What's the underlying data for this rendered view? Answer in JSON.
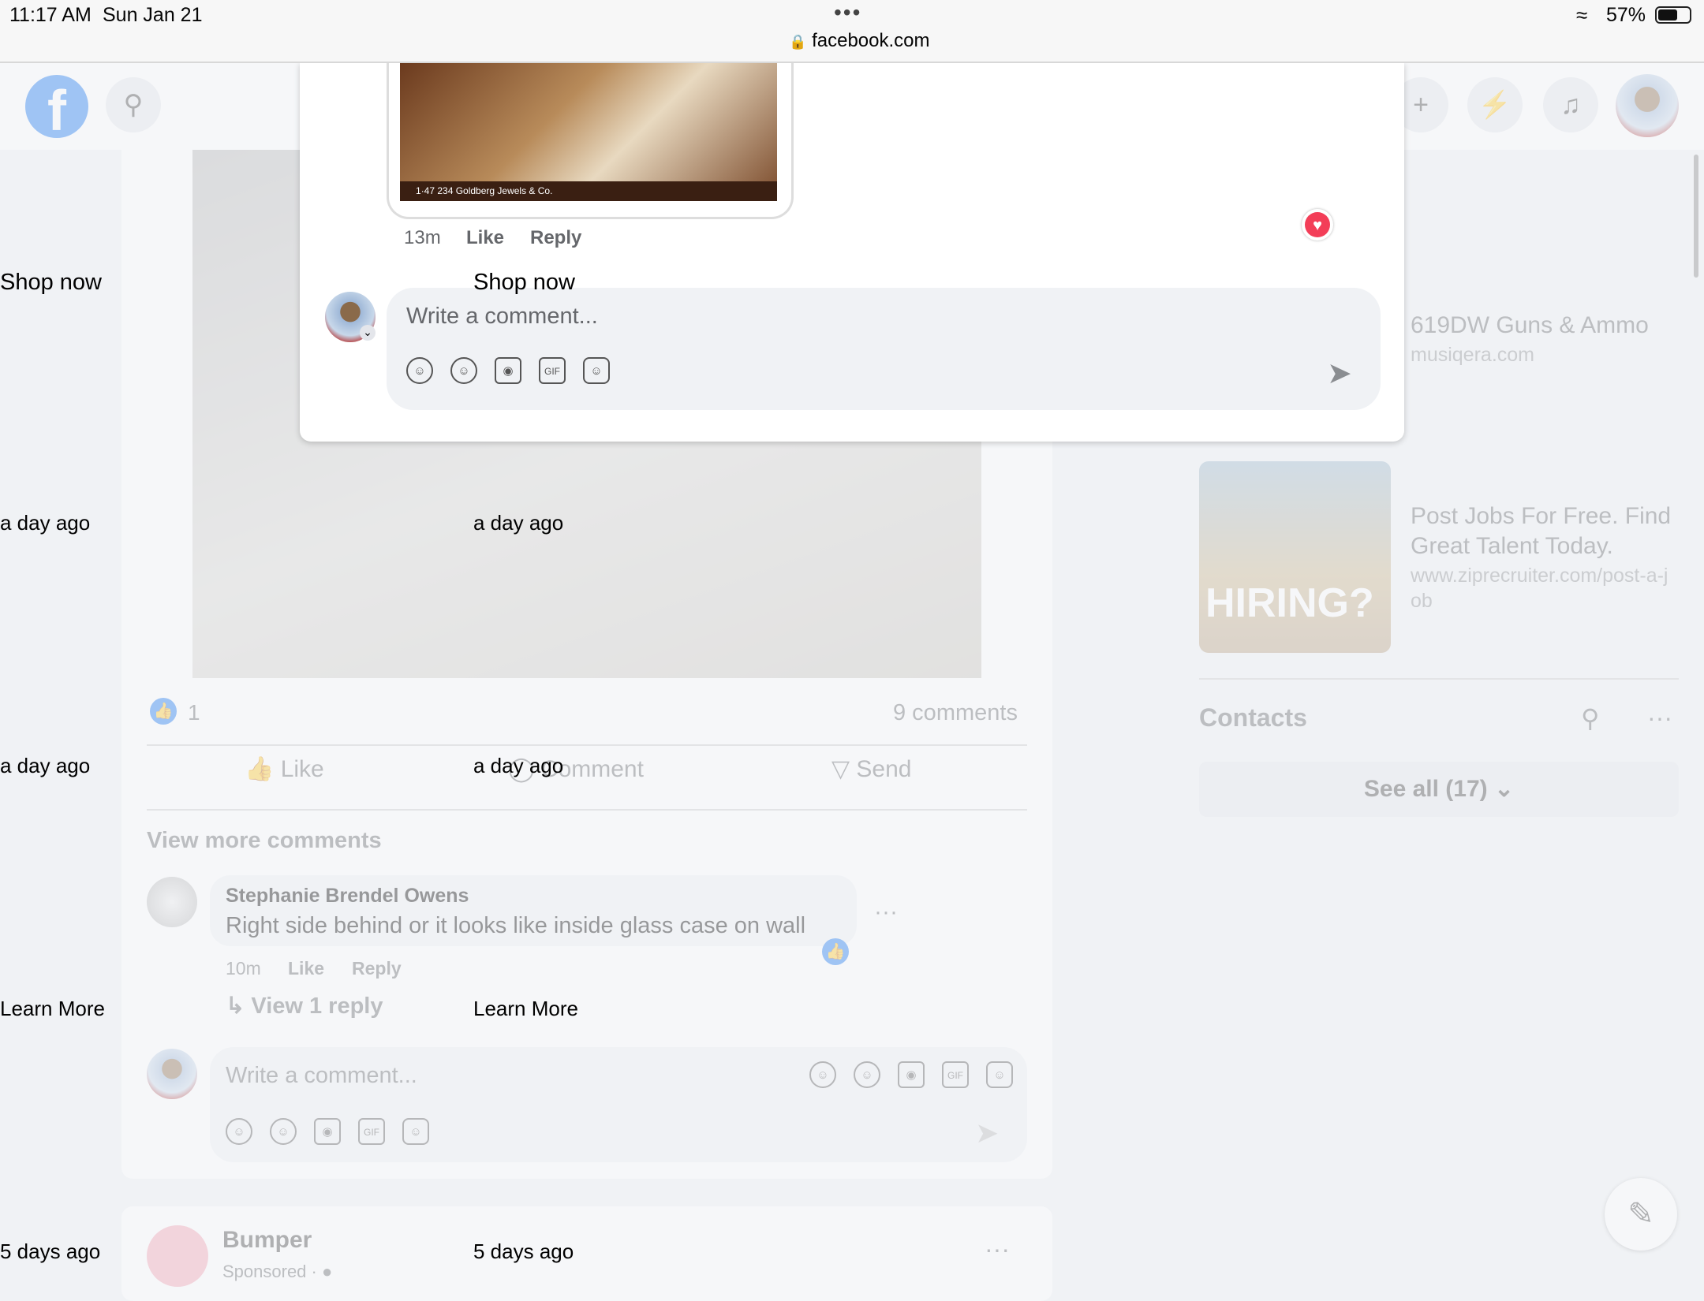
{
  "status_bar": {
    "time": "11:17 AM",
    "date": "Sun Jan 21",
    "url": "facebook.com",
    "battery": "57%"
  },
  "icons": {
    "overflow": "ellipsis-icon",
    "lock": "lock-icon",
    "wifi": "wifi-icon",
    "battery": "battery-icon"
  },
  "modal": {
    "image_caption": "1·47  234  Goldberg Jewels & Co.",
    "comment_time": "13m",
    "like": "Like",
    "reply": "Reply",
    "composer_placeholder": "Write a comment...",
    "gif_label": "GIF"
  },
  "post": {
    "like_count": "1",
    "comment_count": "9 comments",
    "actions": {
      "like": "Like",
      "comment": "Comment",
      "send": "Send"
    },
    "view_more": "View more comments",
    "comment": {
      "author": "Stephanie Brendel Owens",
      "text": "Right side behind or it looks like inside glass case on wall",
      "time": "10m",
      "like": "Like",
      "reply": "Reply"
    },
    "view_reply": "View 1 reply",
    "composer_placeholder": "Write a comment...",
    "gif_label": "GIF"
  },
  "next_post": {
    "author": "Bumper",
    "subtitle": "Sponsored · "
  },
  "right_rail": {
    "ad1": {
      "title": "619DW Guns & Ammo",
      "url": "musiqera.com"
    },
    "ad2": {
      "title": "Post Jobs For Free. Find Great Talent Today.",
      "url": "www.ziprecruiter.com/post-a-job",
      "image_text": "HIRING?"
    },
    "contacts_title": "Contacts",
    "see_all": "See all (17)"
  },
  "overlay": {
    "shop_now": "Shop now",
    "a_day_ago": "a day ago",
    "learn_more": "Learn More",
    "five_days_ago": "5 days ago"
  }
}
